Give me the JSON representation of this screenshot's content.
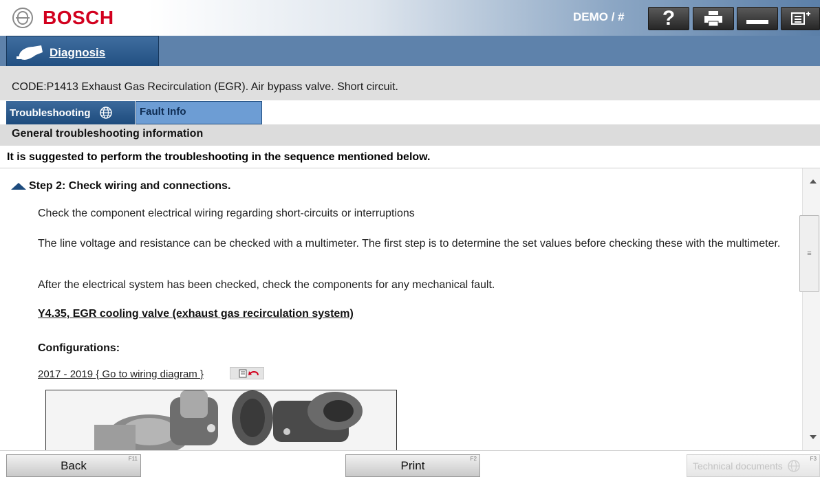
{
  "header": {
    "brand": "BOSCH",
    "user_label": "DEMO / #",
    "buttons": [
      {
        "name": "help",
        "icon": "question-icon",
        "label": "?"
      },
      {
        "name": "print",
        "icon": "printer-icon"
      },
      {
        "name": "minimize",
        "icon": "minimize-icon"
      },
      {
        "name": "menu",
        "icon": "menu-icon"
      }
    ]
  },
  "nav": {
    "main_tab": "Diagnosis"
  },
  "code_line": "CODE:P1413 Exhaust Gas Recirculation (EGR). Air bypass valve. Short circuit.",
  "sub_tabs": [
    {
      "label": "Troubleshooting",
      "icon": "globe-icon",
      "active": true
    },
    {
      "label": "Fault Info",
      "active": false
    }
  ],
  "section_title": "General troubleshooting information",
  "sequence_note": "It is suggested to perform the troubleshooting in the sequence mentioned below.",
  "step": {
    "title": "Step 2: Check wiring and connections.",
    "paragraphs": [
      "Check the component electrical wiring regarding short-circuits or interruptions",
      "The line voltage and resistance can be checked with a multimeter. The first step is to determine the set values before checking these with the multimeter.",
      "After the electrical system has been checked, check the components for any mechanical fault."
    ],
    "component_link": "Y4.35, EGR cooling valve (exhaust gas recirculation system)",
    "configurations_label": "Configurations:",
    "wiring_link": "2017 - 2019 { Go to wiring diagram }"
  },
  "footer": {
    "back": {
      "label": "Back",
      "fkey": "F11"
    },
    "print": {
      "label": "Print",
      "fkey": "F2"
    },
    "tech_docs": {
      "label": "Technical documents",
      "fkey": "F3"
    }
  },
  "colors": {
    "brand_red": "#d2001e",
    "nav_blue": "#1f4d7f",
    "bar_blue": "#5e82ab"
  }
}
